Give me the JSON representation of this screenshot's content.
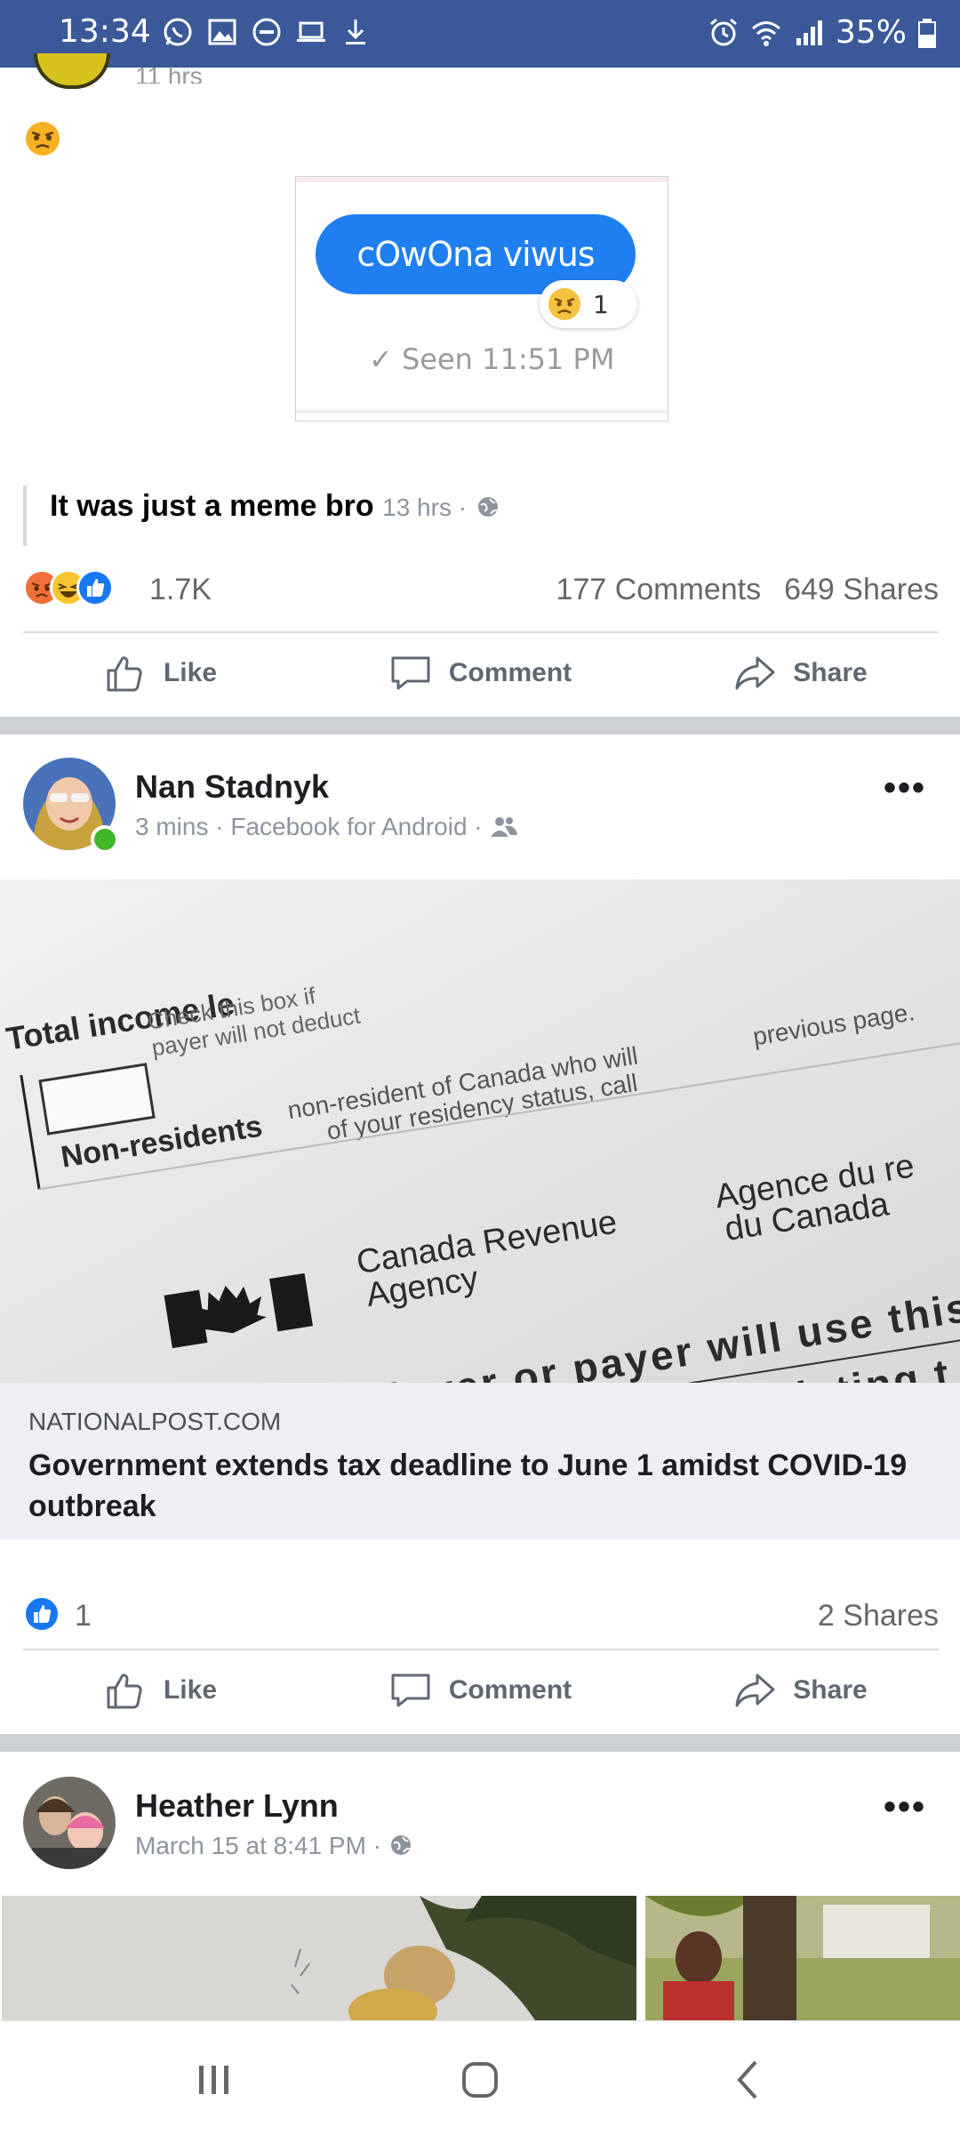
{
  "status_bar": {
    "time": "13:34",
    "battery": "35%",
    "left_icons": [
      "whatsapp-icon",
      "gallery-icon",
      "do-not-disturb-icon",
      "laptop-icon",
      "download-icon"
    ],
    "right_icons": [
      "alarm-icon",
      "wifi-icon",
      "signal-icon",
      "battery-icon"
    ]
  },
  "post1": {
    "meta_cut": "11 hrs",
    "emoji": "angry-face-icon",
    "meme": {
      "bubble_text": "cOwOna viwus",
      "reaction_count": "1",
      "seen_text": "✓ Seen 11:51 PM"
    },
    "quote_text": "It was just a meme bro",
    "quote_meta": "13 hrs ·",
    "reactions_count": "1.7K",
    "comments": "177 Comments",
    "shares": "649 Shares",
    "actions": {
      "like": "Like",
      "comment": "Comment",
      "share": "Share"
    }
  },
  "post2": {
    "author": "Nan Stadnyk",
    "meta": "3 mins · Facebook for Android ·",
    "link": {
      "domain": "NATIONALPOST.COM",
      "headline": "Government extends tax deadline to June 1 amidst COVID-19 outbreak",
      "image_text": {
        "line1": "Total income le",
        "line2": "Check this box if",
        "line3": "payer will not deduct",
        "line4": "Non-residents",
        "line5": "non-resident of Canada who will",
        "line6": "of your residency status, call",
        "line7": "previous page.",
        "agency_en": "Canada Revenue",
        "agency_en2": "Agency",
        "agency_fr": "Agence du re",
        "agency_fr2": "du Canada",
        "big1": "Your employer or payer will use this",
        "big2": "Read the back before completing t"
      }
    },
    "reactions_count": "1",
    "shares": "2 Shares",
    "actions": {
      "like": "Like",
      "comment": "Comment",
      "share": "Share"
    }
  },
  "post3": {
    "author": "Heather Lynn",
    "meta": "March 15 at 8:41 PM ·"
  },
  "colors": {
    "status_bar": "#3b5998",
    "bubble": "#1f7ef0",
    "like_blue": "#1877f2",
    "online_green": "#42b72a",
    "separator": "#cdd0d4"
  }
}
